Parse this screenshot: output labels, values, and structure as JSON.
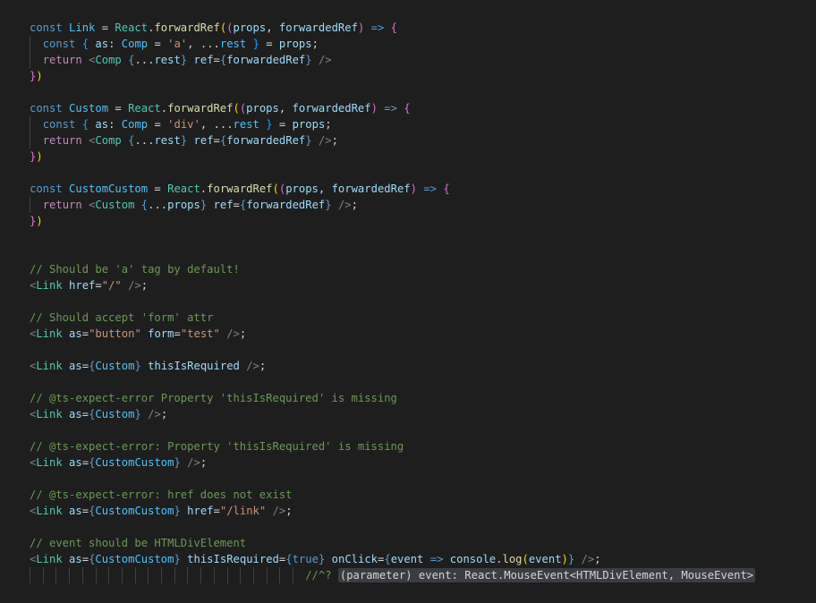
{
  "editor": {
    "background": "#1e1e1e",
    "lines": [
      [
        [
          "kw",
          "const "
        ],
        [
          "const",
          "Link"
        ],
        [
          "txt",
          " = "
        ],
        [
          "tag",
          "React"
        ],
        [
          "txt",
          "."
        ],
        [
          "fn",
          "forwardRef"
        ],
        [
          "b1",
          "("
        ],
        [
          "b2",
          "("
        ],
        [
          "var",
          "props"
        ],
        [
          "txt",
          ", "
        ],
        [
          "var",
          "forwardedRef"
        ],
        [
          "b2",
          ")"
        ],
        [
          "txt",
          " "
        ],
        [
          "kw",
          "=>"
        ],
        [
          "txt",
          " "
        ],
        [
          "b2",
          "{"
        ]
      ],
      [
        [
          "kw",
          "const "
        ],
        [
          "b3",
          "{"
        ],
        [
          "txt",
          " "
        ],
        [
          "var",
          "as"
        ],
        [
          "txt",
          ": "
        ],
        [
          "const",
          "Comp"
        ],
        [
          "txt",
          " = "
        ],
        [
          "str",
          "'a'"
        ],
        [
          "txt",
          ", ..."
        ],
        [
          "const",
          "rest"
        ],
        [
          "txt",
          " "
        ],
        [
          "b3",
          "}"
        ],
        [
          "txt",
          " = "
        ],
        [
          "var",
          "props"
        ],
        [
          "txt",
          ";"
        ]
      ],
      [
        [
          "ctl",
          "return "
        ],
        [
          "pun",
          "<"
        ],
        [
          "tag",
          "Comp"
        ],
        [
          "txt",
          " "
        ],
        [
          "jsx",
          "{"
        ],
        [
          "txt",
          "..."
        ],
        [
          "var",
          "rest"
        ],
        [
          "jsx",
          "}"
        ],
        [
          "txt",
          " "
        ],
        [
          "var",
          "ref"
        ],
        [
          "txt",
          "="
        ],
        [
          "jsx",
          "{"
        ],
        [
          "var",
          "forwardedRef"
        ],
        [
          "jsx",
          "}"
        ],
        [
          "txt",
          " "
        ],
        [
          "pun",
          "/>"
        ]
      ],
      [
        [
          "b2",
          "}"
        ],
        [
          "b1",
          ")"
        ]
      ],
      [],
      [
        [
          "kw",
          "const "
        ],
        [
          "const",
          "Custom"
        ],
        [
          "txt",
          " = "
        ],
        [
          "tag",
          "React"
        ],
        [
          "txt",
          "."
        ],
        [
          "fn",
          "forwardRef"
        ],
        [
          "b1",
          "("
        ],
        [
          "b2",
          "("
        ],
        [
          "var",
          "props"
        ],
        [
          "txt",
          ", "
        ],
        [
          "var",
          "forwardedRef"
        ],
        [
          "b2",
          ")"
        ],
        [
          "txt",
          " "
        ],
        [
          "kw",
          "=>"
        ],
        [
          "txt",
          " "
        ],
        [
          "b2",
          "{"
        ]
      ],
      [
        [
          "kw",
          "const "
        ],
        [
          "b3",
          "{"
        ],
        [
          "txt",
          " "
        ],
        [
          "var",
          "as"
        ],
        [
          "txt",
          ": "
        ],
        [
          "const",
          "Comp"
        ],
        [
          "txt",
          " = "
        ],
        [
          "str",
          "'div'"
        ],
        [
          "txt",
          ", ..."
        ],
        [
          "const",
          "rest"
        ],
        [
          "txt",
          " "
        ],
        [
          "b3",
          "}"
        ],
        [
          "txt",
          " = "
        ],
        [
          "var",
          "props"
        ],
        [
          "txt",
          ";"
        ]
      ],
      [
        [
          "ctl",
          "return "
        ],
        [
          "pun",
          "<"
        ],
        [
          "tag",
          "Comp"
        ],
        [
          "txt",
          " "
        ],
        [
          "jsx",
          "{"
        ],
        [
          "txt",
          "..."
        ],
        [
          "var",
          "rest"
        ],
        [
          "jsx",
          "}"
        ],
        [
          "txt",
          " "
        ],
        [
          "var",
          "ref"
        ],
        [
          "txt",
          "="
        ],
        [
          "jsx",
          "{"
        ],
        [
          "var",
          "forwardedRef"
        ],
        [
          "jsx",
          "}"
        ],
        [
          "txt",
          " "
        ],
        [
          "pun",
          "/>"
        ],
        [
          "txt",
          ";"
        ]
      ],
      [
        [
          "b2",
          "}"
        ],
        [
          "b1",
          ")"
        ]
      ],
      [],
      [
        [
          "kw",
          "const "
        ],
        [
          "const",
          "CustomCustom"
        ],
        [
          "txt",
          " = "
        ],
        [
          "tag",
          "React"
        ],
        [
          "txt",
          "."
        ],
        [
          "fn",
          "forwardRef"
        ],
        [
          "b1",
          "("
        ],
        [
          "b2",
          "("
        ],
        [
          "var",
          "props"
        ],
        [
          "txt",
          ", "
        ],
        [
          "var",
          "forwardedRef"
        ],
        [
          "b2",
          ")"
        ],
        [
          "txt",
          " "
        ],
        [
          "kw",
          "=>"
        ],
        [
          "txt",
          " "
        ],
        [
          "b2",
          "{"
        ]
      ],
      [
        [
          "ctl",
          "return "
        ],
        [
          "pun",
          "<"
        ],
        [
          "tag",
          "Custom"
        ],
        [
          "txt",
          " "
        ],
        [
          "jsx",
          "{"
        ],
        [
          "txt",
          "..."
        ],
        [
          "var",
          "props"
        ],
        [
          "jsx",
          "}"
        ],
        [
          "txt",
          " "
        ],
        [
          "var",
          "ref"
        ],
        [
          "txt",
          "="
        ],
        [
          "jsx",
          "{"
        ],
        [
          "var",
          "forwardedRef"
        ],
        [
          "jsx",
          "}"
        ],
        [
          "txt",
          " "
        ],
        [
          "pun",
          "/>"
        ],
        [
          "txt",
          ";"
        ]
      ],
      [
        [
          "b2",
          "}"
        ],
        [
          "b1",
          ")"
        ]
      ],
      [],
      [],
      [
        [
          "cm",
          "// Should be 'a' tag by default!"
        ]
      ],
      [
        [
          "pun",
          "<"
        ],
        [
          "tag",
          "Link"
        ],
        [
          "txt",
          " "
        ],
        [
          "var",
          "href"
        ],
        [
          "txt",
          "="
        ],
        [
          "str",
          "\"/\""
        ],
        [
          "txt",
          " "
        ],
        [
          "pun",
          "/>"
        ],
        [
          "txt",
          ";"
        ]
      ],
      [],
      [
        [
          "cm",
          "// Should accept 'form' attr"
        ]
      ],
      [
        [
          "pun",
          "<"
        ],
        [
          "tag",
          "Link"
        ],
        [
          "txt",
          " "
        ],
        [
          "var",
          "as"
        ],
        [
          "txt",
          "="
        ],
        [
          "str",
          "\"button\""
        ],
        [
          "txt",
          " "
        ],
        [
          "var",
          "form"
        ],
        [
          "txt",
          "="
        ],
        [
          "str",
          "\"test\""
        ],
        [
          "txt",
          " "
        ],
        [
          "pun",
          "/>"
        ],
        [
          "txt",
          ";"
        ]
      ],
      [],
      [
        [
          "pun",
          "<"
        ],
        [
          "tag",
          "Link"
        ],
        [
          "txt",
          " "
        ],
        [
          "var",
          "as"
        ],
        [
          "txt",
          "="
        ],
        [
          "jsx",
          "{"
        ],
        [
          "const",
          "Custom"
        ],
        [
          "jsx",
          "}"
        ],
        [
          "txt",
          " "
        ],
        [
          "var",
          "thisIsRequired"
        ],
        [
          "txt",
          " "
        ],
        [
          "pun",
          "/>"
        ],
        [
          "txt",
          ";"
        ]
      ],
      [],
      [
        [
          "cm",
          "// @ts-expect-error Property 'thisIsRequired' is missing"
        ]
      ],
      [
        [
          "pun",
          "<"
        ],
        [
          "tag",
          "Link"
        ],
        [
          "txt",
          " "
        ],
        [
          "var",
          "as"
        ],
        [
          "txt",
          "="
        ],
        [
          "jsx",
          "{"
        ],
        [
          "const",
          "Custom"
        ],
        [
          "jsx",
          "}"
        ],
        [
          "txt",
          " "
        ],
        [
          "pun",
          "/>"
        ],
        [
          "txt",
          ";"
        ]
      ],
      [],
      [
        [
          "cm",
          "// @ts-expect-error: Property 'thisIsRequired' is missing"
        ]
      ],
      [
        [
          "pun",
          "<"
        ],
        [
          "tag",
          "Link"
        ],
        [
          "txt",
          " "
        ],
        [
          "var",
          "as"
        ],
        [
          "txt",
          "="
        ],
        [
          "jsx",
          "{"
        ],
        [
          "const",
          "CustomCustom"
        ],
        [
          "jsx",
          "}"
        ],
        [
          "txt",
          " "
        ],
        [
          "pun",
          "/>"
        ],
        [
          "txt",
          ";"
        ]
      ],
      [],
      [
        [
          "cm",
          "// @ts-expect-error: href does not exist"
        ]
      ],
      [
        [
          "pun",
          "<"
        ],
        [
          "tag",
          "Link"
        ],
        [
          "txt",
          " "
        ],
        [
          "var",
          "as"
        ],
        [
          "txt",
          "="
        ],
        [
          "jsx",
          "{"
        ],
        [
          "const",
          "CustomCustom"
        ],
        [
          "jsx",
          "}"
        ],
        [
          "txt",
          " "
        ],
        [
          "var",
          "href"
        ],
        [
          "txt",
          "="
        ],
        [
          "str",
          "\"/link\""
        ],
        [
          "txt",
          " "
        ],
        [
          "pun",
          "/>"
        ],
        [
          "txt",
          ";"
        ]
      ],
      [],
      [
        [
          "cm",
          "// event should be HTMLDivElement"
        ]
      ],
      [
        [
          "pun",
          "<"
        ],
        [
          "tag",
          "Link"
        ],
        [
          "txt",
          " "
        ],
        [
          "var",
          "as"
        ],
        [
          "txt",
          "="
        ],
        [
          "jsx",
          "{"
        ],
        [
          "const",
          "CustomCustom"
        ],
        [
          "jsx",
          "}"
        ],
        [
          "txt",
          " "
        ],
        [
          "var",
          "thisIsRequired"
        ],
        [
          "txt",
          "="
        ],
        [
          "jsx",
          "{"
        ],
        [
          "kw",
          "true"
        ],
        [
          "jsx",
          "}"
        ],
        [
          "txt",
          " "
        ],
        [
          "var",
          "onClick"
        ],
        [
          "txt",
          "="
        ],
        [
          "jsx",
          "{"
        ],
        [
          "var",
          "event"
        ],
        [
          "txt",
          " "
        ],
        [
          "kw",
          "=>"
        ],
        [
          "txt",
          " "
        ],
        [
          "var",
          "console"
        ],
        [
          "txt",
          "."
        ],
        [
          "fn",
          "log"
        ],
        [
          "b1",
          "("
        ],
        [
          "var",
          "event"
        ],
        [
          "b1",
          ")"
        ],
        [
          "jsx",
          "}"
        ],
        [
          "txt",
          " "
        ],
        [
          "pun",
          "/>"
        ],
        [
          "txt",
          ";"
        ]
      ],
      [
        [
          "txt",
          "                                          "
        ],
        [
          "cm",
          "//^? "
        ],
        [
          "hint",
          "(parameter) event: React.MouseEvent<HTMLDivElement, MouseEvent>"
        ]
      ]
    ]
  }
}
